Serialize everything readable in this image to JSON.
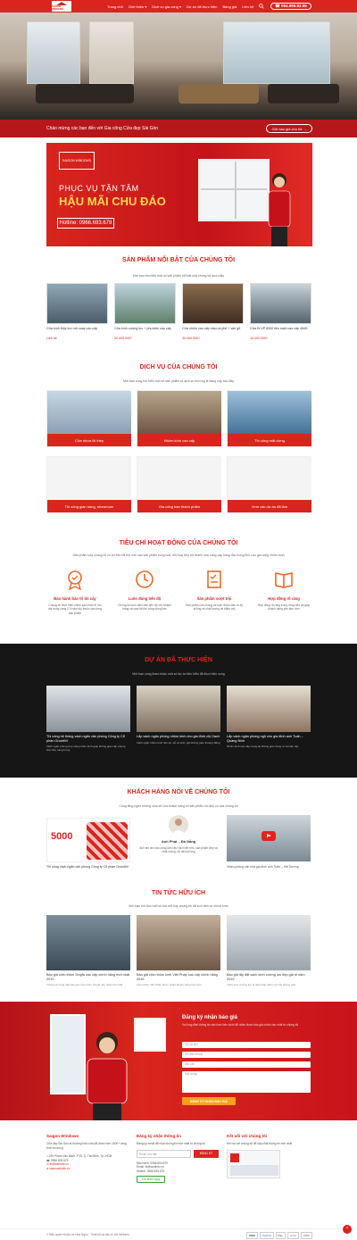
{
  "header": {
    "logo_text": "SAIGON WINDOWS",
    "nav": [
      "Trang chủ",
      "Giới thiệu ▾",
      "Dịch vụ gia công ▾",
      "Dự án đã thực hiện",
      "Bảng giá",
      "Liên hệ"
    ],
    "hotline": "☎ 094.999.92.95",
    "accent": "#d9251d"
  },
  "hero": {
    "welcome": "Chào mừng các bạn đến với Gia công Cửa đẹp Sài Gòn",
    "cta": "Gửi báo giá cho tôi →"
  },
  "banner": {
    "brand": "SAIGON WINDOWS",
    "line1": "PHỤC VỤ TẬN TÂM",
    "line2": "HẬU MÃI CHU ĐÁO",
    "hotline": "Hotline: 0966.693.679"
  },
  "products": {
    "title": "SẢN PHẨM NỔI BẬT CỦA CHÚNG TÔI",
    "subtitle": "Mời bạn tìm hiểu một số sản phẩm nổi bật của chúng tôi dưới đây",
    "items": [
      {
        "name": "Cửa kính thủy lực mở xoay cao cấp",
        "price": "Liên hệ"
      },
      {
        "name": "Cửa kính cường lực + phụ kiện cao cấp",
        "price": "30.000.000₫"
      },
      {
        "name": "Cửa nhôm cao cấp màu cà phê + vân gỗ",
        "price": "30.000.000₫"
      },
      {
        "name": "Cửa Đi VP 6000 tiêu sách cao cấp 4lh02",
        "price": "15.000.000₫"
      }
    ]
  },
  "services": {
    "title": "DỊCH VỤ CỦA CHÚNG TÔI",
    "subtitle": "Mời bạn cùng tìm hiểu một số sản phẩm và dịch vụ thường lệ đang cấp sau đây",
    "items": [
      "Cửa nhựa lõi thép",
      "Nhôm kính cao cấp",
      "Thi công mặt dựng",
      "Thi công gian hàng, showroom",
      "Gia công bán thành phẩm",
      "Xem các dự án đã làm"
    ]
  },
  "criteria": {
    "title": "TIÊU CHÍ HOẠT ĐỘNG CỦA CHÚNG TÔI",
    "subtitle": "Sản phẩm của chúng tôi có lợi thế nổi trội hơn các sản phẩm cùng loại, với mục tiêu trở thành nhà cung cấp hàng đầu trong lĩnh vực gia công nhôm kính",
    "items": [
      {
        "name": "Bảo hành bảo trì tin cậy",
        "desc": "Chúng tôi thực hiện chính sách bảo trì lâu dài trong vòng 2-3 năm tùy thuộc vào từng sản phẩm"
      },
      {
        "name": "Luôn đúng tiến độ",
        "desc": "Chúng tôi luôn đảm bảo tiến độ cho khách hàng và cam kết thi công đúng hạn"
      },
      {
        "name": "Sản phẩm vượt trội",
        "desc": "Sản phẩm của chúng tôi luôn được đầu tư kỹ lưỡng về chất lượng và thẩm mỹ"
      },
      {
        "name": "Hợp đồng rõ ràng",
        "desc": "Hợp đồng rõ ràng trong từng việc và giúp khách hàng yên tâm hơn"
      }
    ]
  },
  "projects": {
    "title": "DỰ ÁN ĐÃ THỰC HIỆN",
    "subtitle": "Mời bạn cùng tham khảo một số dự án tiêu biểu đã thực hiện xong",
    "items": [
      {
        "name": "Thi công hệ thống vách ngăn văn phòng Công ty Cổ phần GrowthV",
        "desc": "Vách ngăn phòng họp cũng nhôm kính giúp không gian văn phòng hiện đại, sang trọng"
      },
      {
        "name": "Lắp vách ngăn phòng nhôm kính cho gia đình chị Oanh",
        "desc": "Vách ngăn nhôm kính tiện lợi, dễ vệ sinh, giữ không gian thoáng đãng"
      },
      {
        "name": "Lắp vách ngăn phòng ngủ cho gia đình anh Tuấn – Quảng Ninh",
        "desc": "Nhôm kính cao cấp mang lại không gian riêng tư và hiện đại"
      }
    ]
  },
  "testimonials": {
    "title": "KHÁCH HÀNG NÓI VỀ CHÚNG TÔI",
    "subtitle": "Cùng lắng nghe những chia sẻ của khách hàng về sản phẩm và dịch vụ của chúng tôi",
    "badge": "5000",
    "caption_left": "Thi công vách ngăn văn phòng Công ty Cổ phần GrowthV",
    "person_name": "Anh Phát – Đà Nẵng",
    "person_quote": "Anh em lần nào cũng làm việc rất nhiệt tình, sản phẩm đẹp và chất lượng, tôi rất hài lòng",
    "video_caption": "Video phỏng vấn nhà gia đình anh Tuấn – Hải Dương"
  },
  "news": {
    "title": "TIN TỨC HỮU ÍCH",
    "subtitle": "Mời bạn tìm đọc một số bài viết hay chúng tôi đã sưu tầm về nhôm kính",
    "items": [
      {
        "name": "Báo giá cửa nhôm Xingfa cao cấp chính hãng mới nhất 2019",
        "desc": "Chúng tôi cung cấp báo giá cửa nhôm Xingfa cập nhật mới nhất"
      },
      {
        "name": "Báo giá cửa nhôm kính Việt Pháp cao cấp chính hãng 2019",
        "desc": "Cửa nhôm Việt Pháp được nhiều khách hàng lựa chọn"
      },
      {
        "name": "Báo giá lắp đặt vách kính cường lực đẹp giá rẻ năm 2019",
        "desc": "Vách kính cường lực là giải pháp thẩm mỹ cho không gian"
      }
    ]
  },
  "quote_form": {
    "title": "Đăng ký nhận báo giá",
    "subtitle": "Vui lòng điền thông tin vào form bên dưới để nhận được báo giá chính xác nhất từ chúng tôi",
    "fields": [
      "Họ và tên",
      "Số điện thoại",
      "Địa chỉ",
      "Nội dung"
    ],
    "submit": "ĐĂNG KÝ NHẬN BÁO GIÁ"
  },
  "footer": {
    "about_title": "Saigon Windows",
    "about_text": "Cửa đẹp Sài Gòn là thương hiệu cửa đã được hơn 1000+ công trình tin dùng",
    "address": "249 Phạm Văn Bạch, P.15, Q. Tân Bình, Tp. HCM",
    "phone": "0966.693.679",
    "email": "tb@webinfo.vn",
    "web": "www.webinfo.vn",
    "news_title": "Đăng ký nhận thông tin",
    "news_text": "Đăng ký email để nhận thông tin mới nhất từ chúng tôi",
    "email_placeholder": "Email của bạn",
    "subscribe": "ĐĂNG KÝ",
    "links": [
      "Bảo hành: 0966.693.679",
      "Email: tb@webinfo.vn",
      "Hotline: 0966.693.679"
    ],
    "more_btn": "Tìm kiếm ngay",
    "connect_title": "Kết nối với chúng tôi",
    "connect_text": "Kết nối với chúng tôi để cập nhật thông tin mới nhất",
    "copyright": "© Bản quyền thuộc về Nhà Ngon · Thiết kế và bảo trì bởi Webinfo",
    "payments": [
      "VISA",
      "PayPal",
      "Pay",
      "stripe",
      "2023"
    ]
  }
}
